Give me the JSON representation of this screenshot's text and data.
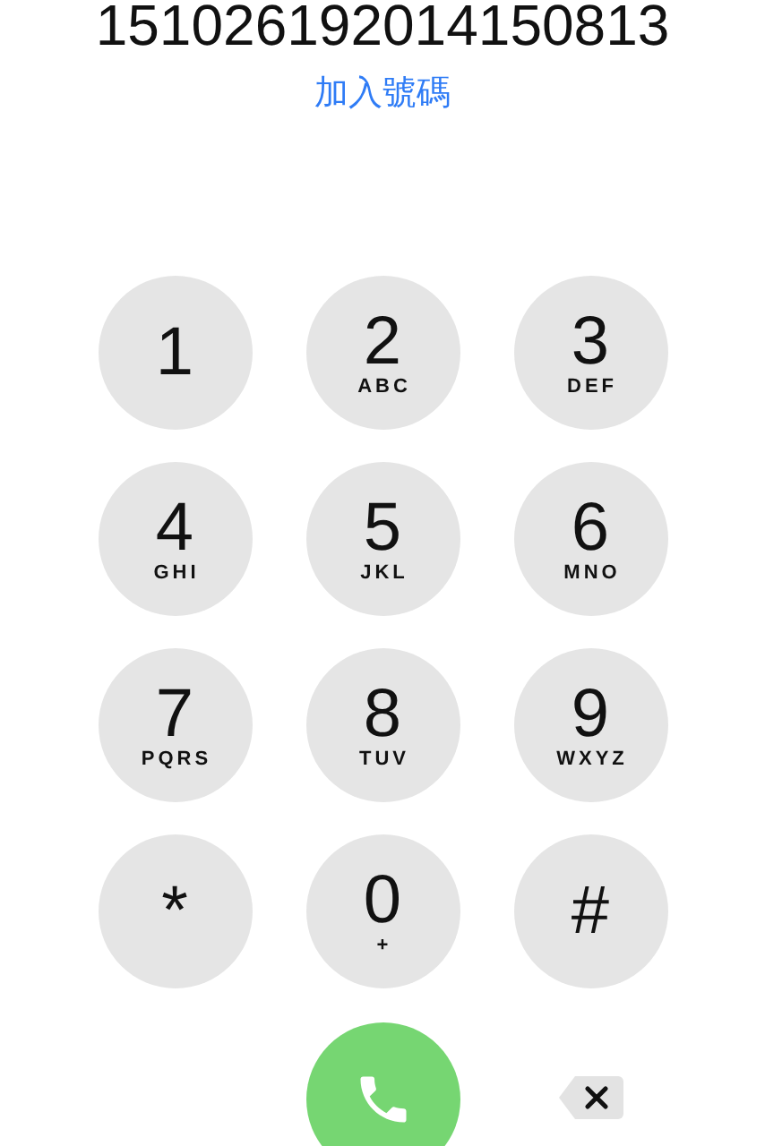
{
  "number": "151026192014150813",
  "add_number": "加入號碼",
  "keys": [
    {
      "digit": "1"
    },
    {
      "digit": "2",
      "letters": "ABC"
    },
    {
      "digit": "3",
      "letters": "DEF"
    },
    {
      "digit": "4",
      "letters": "GHI"
    },
    {
      "digit": "5",
      "letters": "JKL"
    },
    {
      "digit": "6",
      "letters": "MNO"
    },
    {
      "digit": "7",
      "letters": "PQRS"
    },
    {
      "digit": "8",
      "letters": "TUV"
    },
    {
      "digit": "9",
      "letters": "WXYZ"
    },
    {
      "digit": "*"
    },
    {
      "digit": "0",
      "letters": "+"
    },
    {
      "digit": "#"
    }
  ]
}
